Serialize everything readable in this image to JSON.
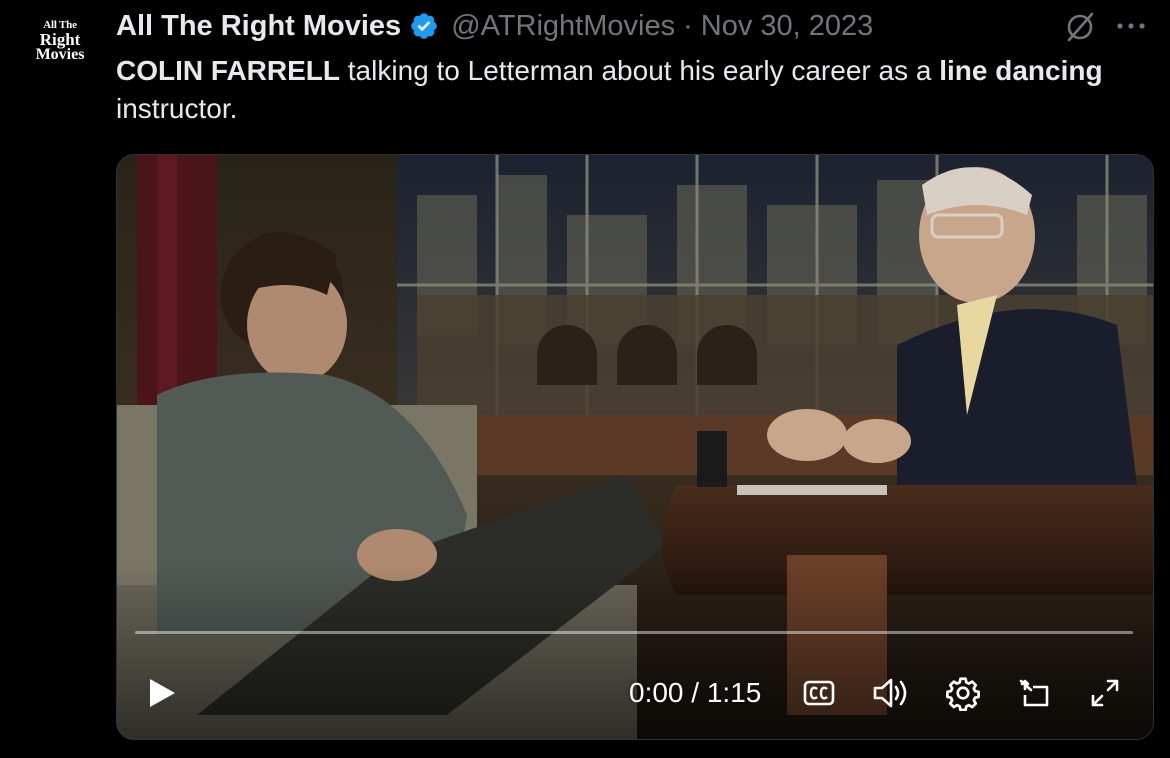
{
  "tweet": {
    "avatar": {
      "line1": "All The",
      "line2": "Right",
      "line3": "Movies"
    },
    "display_name": "All The Right Movies",
    "handle": "@ATRightMovies",
    "separator": "·",
    "date": "Nov 30, 2023",
    "text": {
      "part1": "COLIN FARRELL",
      "part2": " talking to Letterman about his early career as a ",
      "part3": "line dancing",
      "part4": " instructor."
    }
  },
  "video": {
    "current_time": "0:00",
    "time_separator": " / ",
    "duration": "1:15",
    "progress": 0,
    "icons": [
      "play-icon",
      "closed-captions-icon",
      "volume-icon",
      "settings-icon",
      "picture-in-picture-icon",
      "fullscreen-icon"
    ]
  },
  "colors": {
    "background": "#000000",
    "text": "#e7e9ea",
    "muted": "#71767b",
    "verified": "#1d9bf0"
  }
}
